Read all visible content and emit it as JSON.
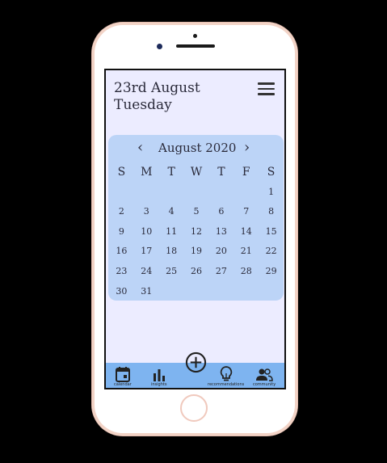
{
  "header": {
    "date_line1": "23rd August",
    "date_line2": "Tuesday"
  },
  "calendar": {
    "month_label": "August 2020",
    "weekdays": [
      "S",
      "M",
      "T",
      "W",
      "T",
      "F",
      "S"
    ],
    "weeks": [
      [
        "",
        "",
        "",
        "",
        "",
        "",
        "1"
      ],
      [
        "2",
        "3",
        "4",
        "5",
        "6",
        "7",
        "8"
      ],
      [
        "9",
        "10",
        "11",
        "12",
        "13",
        "14",
        "15"
      ],
      [
        "16",
        "17",
        "18",
        "19",
        "20",
        "21",
        "22"
      ],
      [
        "23",
        "24",
        "25",
        "26",
        "27",
        "28",
        "29"
      ],
      [
        "30",
        "31",
        "",
        "",
        "",
        "",
        ""
      ]
    ]
  },
  "tabs": {
    "calendar": "calendar",
    "insights": "insights",
    "recommendations": "recommendations",
    "community": "community"
  },
  "colors": {
    "screen_bg": "#ececff",
    "calendar_bg": "#bcd4f7",
    "tabbar_bg": "#7eb4f0"
  }
}
